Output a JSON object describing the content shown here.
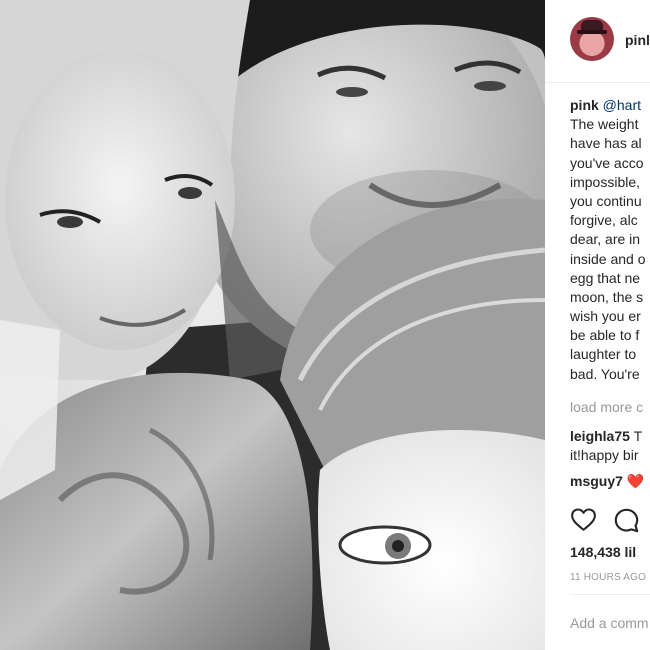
{
  "post": {
    "username": "pinl",
    "photo_description": "black-and-white selfie of a smiling woman, a man in a dark beanie and a child's face in the foreground",
    "caption": {
      "author": "pink",
      "mention": "@hart",
      "lines": [
        "The weight",
        "have has al",
        "you've acco",
        "impossible,",
        "you continu",
        "forgive, alc",
        "dear, are in",
        "inside and o",
        "egg that ne",
        "moon, the s",
        "wish you er",
        "be able to f",
        "laughter to",
        "bad. You're"
      ]
    },
    "load_more_label": "load more c",
    "comments": [
      {
        "author": "leighla75",
        "text_first": "T",
        "text_more": "it!happy bir"
      },
      {
        "author": "msguy7",
        "emoji": "❤️"
      }
    ],
    "actions": {
      "like_icon": "heart-icon",
      "comment_icon": "comment-icon"
    },
    "likes_text": "148,438 lil",
    "time_text": "11 HOURS AGO",
    "add_comment_placeholder": "Add a comm"
  },
  "colors": {
    "text": "#262626",
    "muted": "#999999",
    "link": "#003569",
    "divider": "#efefef",
    "heart": "#e0245e"
  }
}
